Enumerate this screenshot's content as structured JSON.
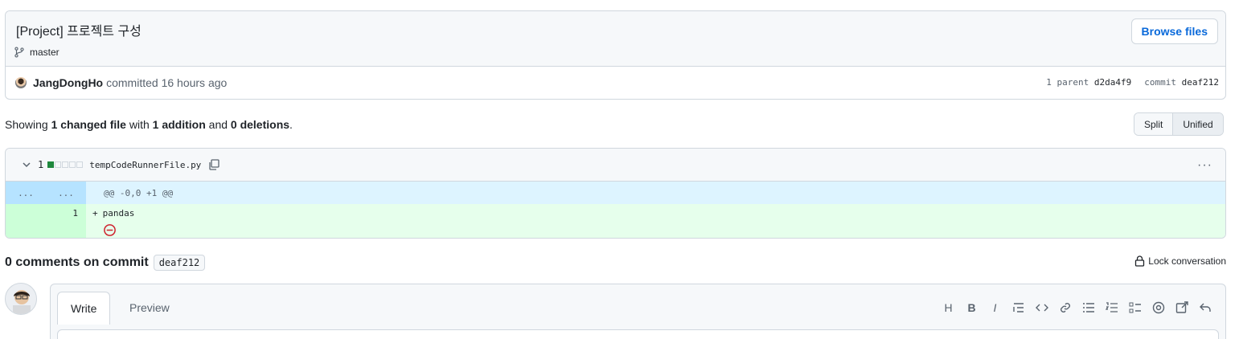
{
  "commit": {
    "title": "[Project] 프로젝트 구성",
    "branch": "master",
    "browse_label": "Browse files",
    "author": "JangDongHo",
    "committed_text": "committed 16 hours ago",
    "parent_label": "1 parent",
    "parent_sha": "d2da4f9",
    "commit_label": "commit",
    "commit_sha": "deaf212"
  },
  "summary": {
    "showing": "Showing",
    "files": "1 changed file",
    "with": "with",
    "additions": "1 addition",
    "and": "and",
    "deletions": "0 deletions",
    "period": "."
  },
  "view_toggle": {
    "split": "Split",
    "unified": "Unified"
  },
  "diff": {
    "change_count": "1",
    "filename": "tempCodeRunnerFile.py",
    "more": "···",
    "hunk_old": "...",
    "hunk_new": "...",
    "hunk_header": "@@ -0,0 +1 @@",
    "line_no": "1",
    "sign": "+",
    "code": "pandas"
  },
  "comments": {
    "title": "0 comments on commit",
    "sha": "deaf212",
    "lock_label": "Lock conversation",
    "tab_write": "Write",
    "tab_preview": "Preview"
  },
  "icons": {
    "branch": "git-branch-icon",
    "chevron": "chevron-down-icon",
    "copy": "copy-icon",
    "kebab": "kebab-horizontal-icon",
    "minus": "minus-circle-icon",
    "lock": "lock-icon"
  },
  "colors": {
    "link": "#0969da",
    "addition": "#1f883d",
    "deletion": "#cf222e",
    "hunk_bg": "#ddf4ff",
    "add_bg": "#e6ffec"
  }
}
